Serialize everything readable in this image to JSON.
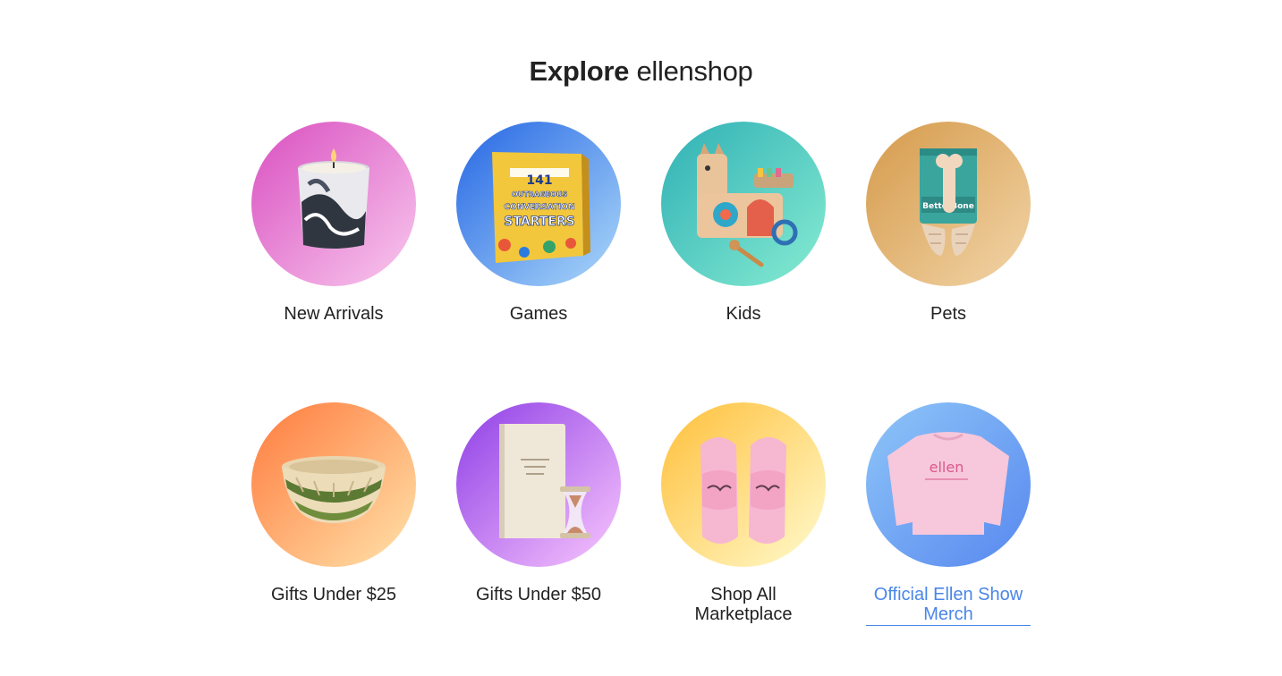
{
  "heading": {
    "bold": "Explore",
    "light": "ellenshop"
  },
  "categories": [
    {
      "label": "New Arrivals",
      "icon": "candle-icon",
      "gradient": [
        "#d94fc0",
        "#f4b7e7"
      ]
    },
    {
      "label": "Games",
      "icon": "card-game-box-icon",
      "gradient": [
        "#2566e4",
        "#9fcdf7"
      ],
      "product_text": [
        "141",
        "OUTRAGEOUS",
        "CONVERSATION",
        "STARTERS"
      ]
    },
    {
      "label": "Kids",
      "icon": "wooden-llama-toy-icon",
      "gradient": [
        "#2fb0b5",
        "#7ee6cf"
      ]
    },
    {
      "label": "Pets",
      "icon": "dog-chew-toy-icon",
      "gradient": [
        "#d59a4a",
        "#efcf9f"
      ],
      "product_text": [
        "BetterBone"
      ]
    },
    {
      "label": "Gifts Under $25",
      "icon": "woven-basket-icon",
      "gradient": [
        "#ff7a3d",
        "#ffd9a0"
      ]
    },
    {
      "label": "Gifts Under $50",
      "icon": "journal-hourglass-icon",
      "gradient": [
        "#8e3ee6",
        "#efb9fb"
      ]
    },
    {
      "label": "Shop All Marketplace",
      "icon": "slippers-icon",
      "gradient": [
        "#ffbf3a",
        "#fff5bf"
      ]
    },
    {
      "label": "Official Ellen Show Merch",
      "icon": "ellen-sweatshirt-icon",
      "gradient": [
        "#8ec6f8",
        "#5d8ef0"
      ],
      "product_text": [
        "ellen"
      ],
      "link_color": "#4a86e8"
    }
  ]
}
